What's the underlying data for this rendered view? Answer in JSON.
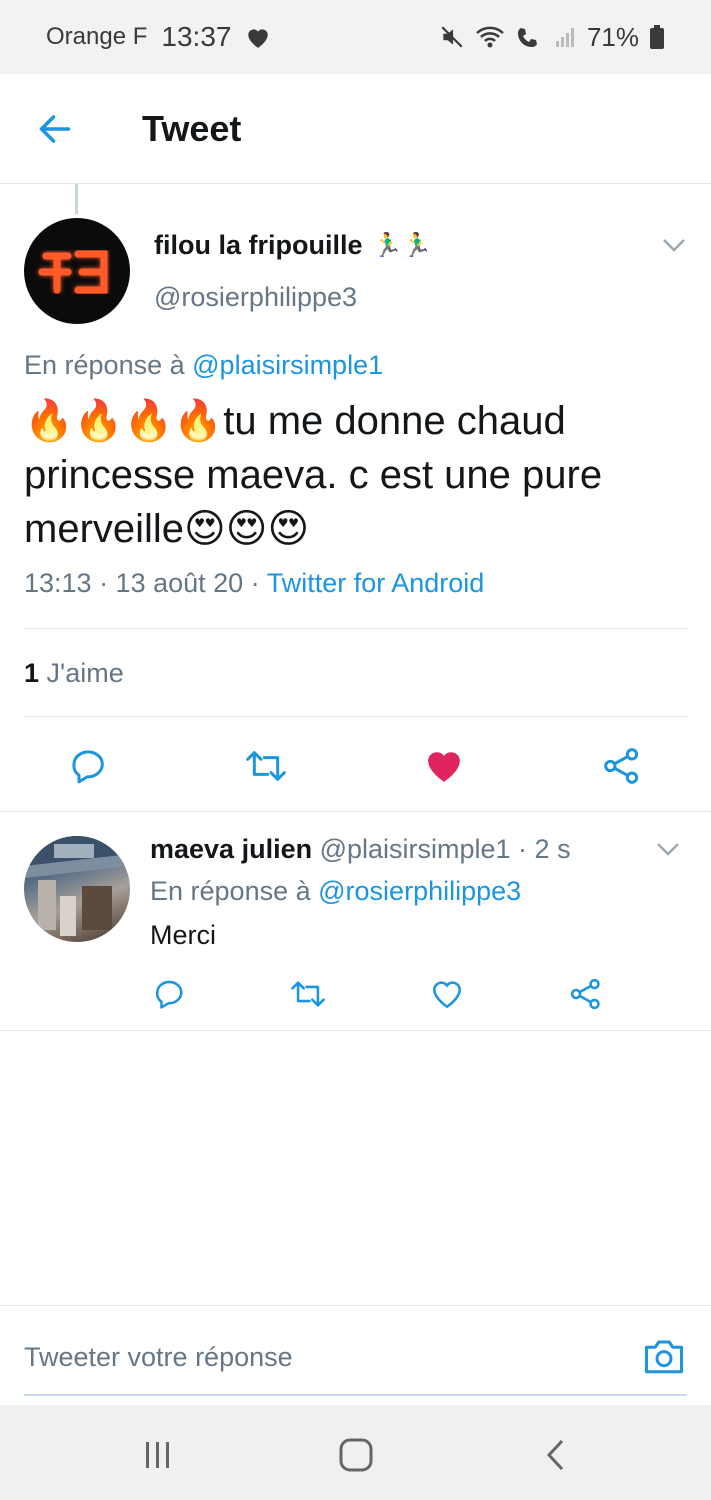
{
  "status_bar": {
    "carrier": "Orange F",
    "time": "13:37",
    "battery": "71%"
  },
  "app_bar": {
    "title": "Tweet"
  },
  "main_tweet": {
    "author_name": "filou la fripouille",
    "author_emoji": "🏃‍♂️🏃‍♂️",
    "handle": "@rosierphilippe3",
    "reply_prefix": "En réponse à",
    "reply_mention": "@plaisirsimple1",
    "text": "🔥🔥🔥🔥tu me donne chaud princesse maeva. c est une pure merveille😍😍😍",
    "timestamp": "13:13 · 13 août 20 · ",
    "source": "Twitter for Android",
    "likes_count": "1",
    "likes_label": " J'aime"
  },
  "reply_tweet": {
    "author_name": "maeva julien",
    "handle_time": " @plaisirsimple1 · 2 s",
    "reply_prefix": "En réponse à",
    "reply_mention": "@rosierphilippe3",
    "text": "Merci"
  },
  "composer": {
    "placeholder": "Tweeter votre réponse"
  },
  "colors": {
    "accent": "#1b95e0",
    "like_active": "#e0245e",
    "secondary_text": "#657786"
  }
}
